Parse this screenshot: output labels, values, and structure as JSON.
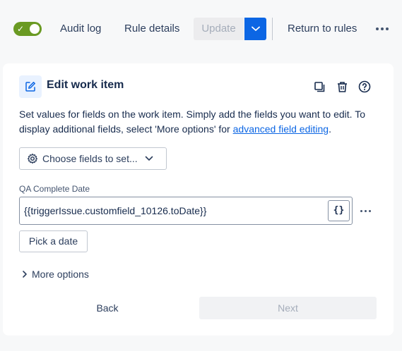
{
  "topbar": {
    "toggle_state": "on",
    "audit_log": "Audit log",
    "rule_details": "Rule details",
    "update": "Update",
    "return_to_rules": "Return to rules",
    "accent_color": "#0c66e4",
    "toggle_color": "#6a9a23"
  },
  "card": {
    "title": "Edit work item",
    "description_text": "Set values for fields on the work item. Simply add the fields you want to edit. To display additional fields, select 'More options' for ",
    "description_link": "advanced field editing",
    "description_end": ".",
    "choose_fields": "Choose fields to set...",
    "field": {
      "label": "QA Complete Date",
      "value": "{{triggerIssue.customfield_10126.toDate}}",
      "braces": "{}"
    },
    "pick_date": "Pick a date",
    "more_options": "More options",
    "back": "Back",
    "next": "Next"
  },
  "icons": {
    "header": [
      "edit-icon",
      "copy-icon",
      "trash-icon",
      "help-icon"
    ],
    "misc": [
      "gear-icon",
      "chevron-down-icon",
      "chevron-right-icon",
      "more-icon"
    ]
  }
}
